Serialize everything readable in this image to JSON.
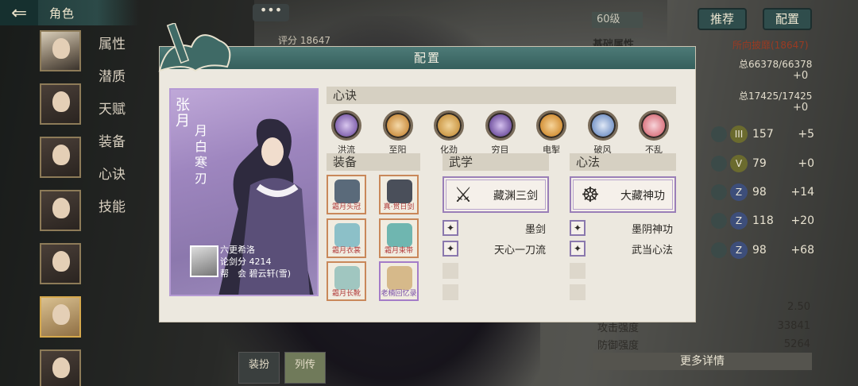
{
  "topbar": {
    "title": "角色"
  },
  "nav": {
    "items": [
      "属性",
      "潜质",
      "天赋",
      "装备",
      "心诀",
      "技能"
    ]
  },
  "header": {
    "more": "•••",
    "score": "评分 18647",
    "level": "60级",
    "recommend": "推荐",
    "config": "配置"
  },
  "stats": {
    "base_title": "基础属性",
    "source": "所向披靡(18647)",
    "hp": "总66378/66378",
    "hp_plus": "+0",
    "mp": "总17425/17425",
    "mp_plus": "+0",
    "rows": [
      {
        "badge": "III",
        "value": "157",
        "plus": "+5"
      },
      {
        "badge": "V",
        "value": "79",
        "plus": "+0"
      },
      {
        "badge": "Z",
        "value": "98",
        "plus": "+14"
      },
      {
        "badge": "Z",
        "value": "118",
        "plus": "+20"
      },
      {
        "badge": "Z",
        "value": "98",
        "plus": "+68"
      }
    ],
    "extra": [
      {
        "label": "",
        "value": "2.50"
      },
      {
        "label": "攻击强度",
        "value": "33841"
      },
      {
        "label": "防御强度",
        "value": "5264"
      }
    ],
    "more_detail": "更多详情"
  },
  "bottom_tabs": [
    {
      "label": "装扮"
    },
    {
      "label": "列传"
    }
  ],
  "dialog": {
    "title": "配置",
    "card": {
      "surname": "张月",
      "title": "月白寒刃",
      "player": "六更希洛",
      "score": "论剑分 4214",
      "guild_label": "帮　会",
      "guild": "碧云轩(雪)"
    },
    "xinjue": {
      "header": "心诀",
      "items": [
        {
          "label": "洪流",
          "color": "#7a5aa8"
        },
        {
          "label": "至阳",
          "color": "#c98a3a"
        },
        {
          "label": "化劲",
          "color": "#c8923e"
        },
        {
          "label": "穷目",
          "color": "#6a4a9a"
        },
        {
          "label": "电掣",
          "color": "#d08a2e"
        },
        {
          "label": "破风",
          "color": "#6f8fc4"
        },
        {
          "label": "不乱",
          "color": "#d86d78"
        }
      ]
    },
    "equip": {
      "header": "装备",
      "items": [
        {
          "label": "霜月头冠",
          "tone": "red"
        },
        {
          "label": "真·贯日剑",
          "tone": "red"
        },
        {
          "label": "霜月衣裳",
          "tone": "red"
        },
        {
          "label": "霜月束带",
          "tone": "red"
        },
        {
          "label": "霜月长靴",
          "tone": "red"
        },
        {
          "label": "老楠回忆录",
          "tone": "purple"
        }
      ]
    },
    "wuxue": {
      "header": "武学",
      "main": "藏渊三剑",
      "subs": [
        "墨剑",
        "天心一刀流"
      ]
    },
    "xinfa": {
      "header": "心法",
      "main": "大藏神功",
      "subs": [
        "墨阴神功",
        "武当心法"
      ]
    }
  }
}
